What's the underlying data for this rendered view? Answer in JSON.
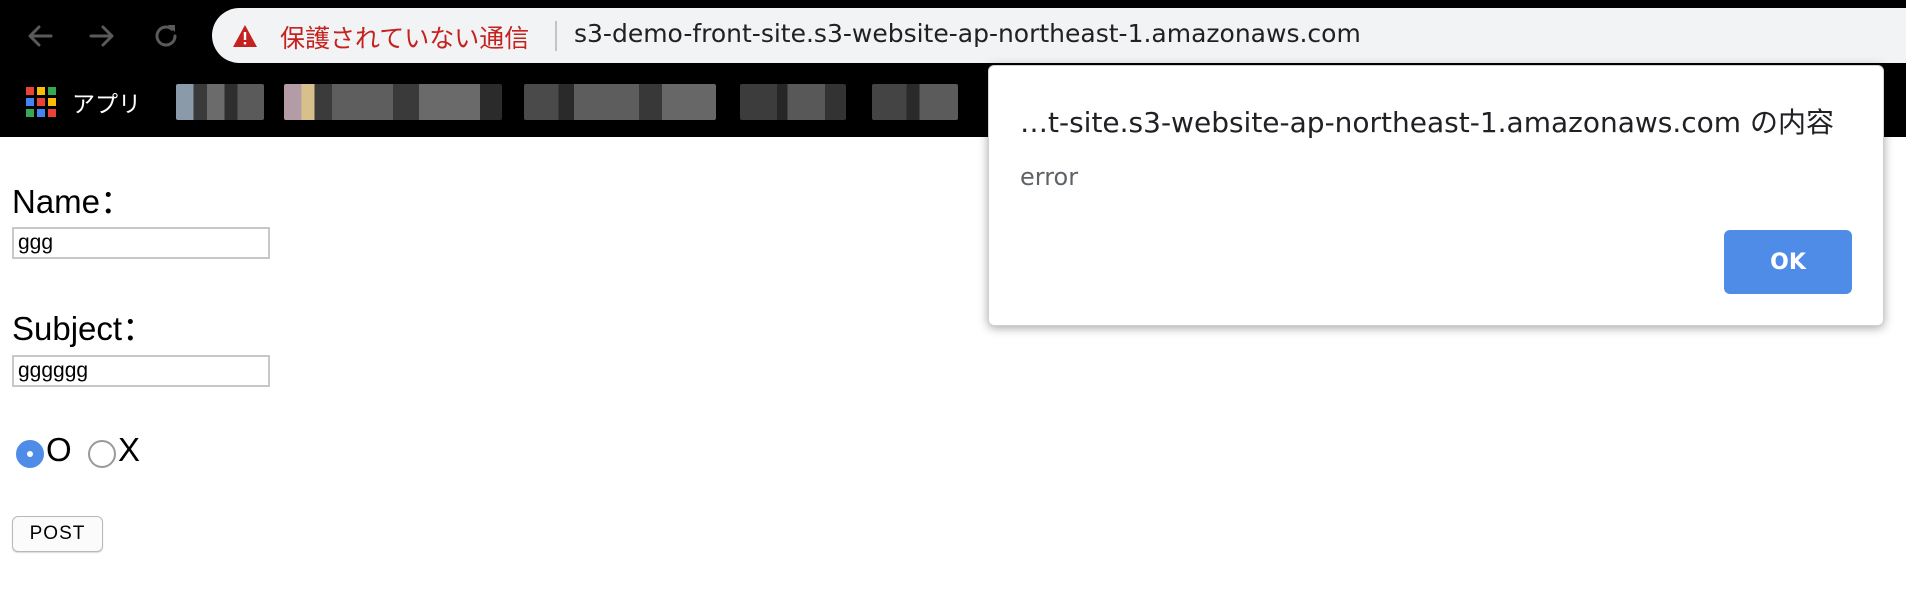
{
  "browser": {
    "security_warning": "保護されていない通信",
    "url": "s3-demo-front-site.s3-website-ap-northeast-1.amazonaws.com",
    "bookmarks_apps_label": "アプリ"
  },
  "form": {
    "name_label": "Name：",
    "name_value": "ggg",
    "subject_label": "Subject：",
    "subject_value": "gggggg",
    "radio_options": [
      {
        "label": "O",
        "selected": true
      },
      {
        "label": "X",
        "selected": false
      }
    ],
    "post_label": "POST"
  },
  "dialog": {
    "title": "…t-site.s3-website-ap-northeast-1.amazonaws.com の内容",
    "message": "error",
    "ok_label": "OK"
  },
  "colors": {
    "accent": "#4f8ce8",
    "warning": "#c5221f"
  }
}
